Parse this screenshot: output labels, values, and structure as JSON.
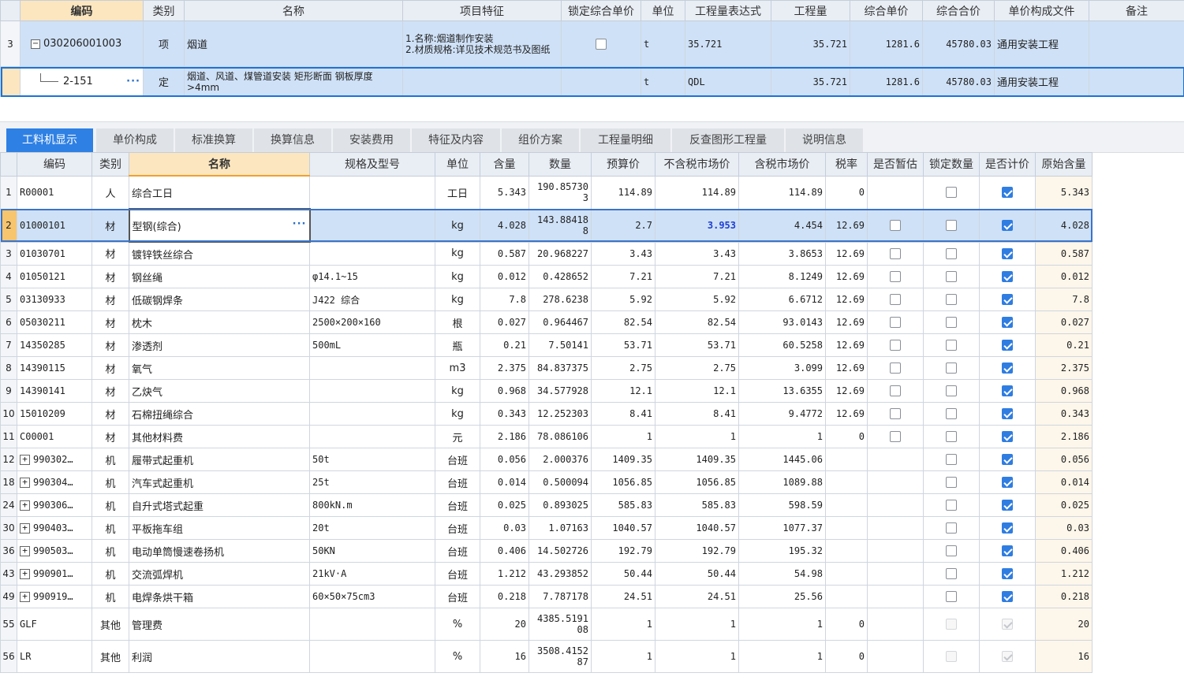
{
  "top_grid": {
    "headers": [
      "编码",
      "类别",
      "名称",
      "项目特征",
      "锁定综合单价",
      "单位",
      "工程量表达式",
      "工程量",
      "综合单价",
      "综合合价",
      "单价构成文件",
      "备注"
    ],
    "rows": [
      {
        "rowno": "3",
        "code": "030206001003",
        "type": "项",
        "name": "烟道",
        "feature_lines": [
          "1.名称:烟道制作安装",
          "2.材质规格:详见技术规范书及图纸"
        ],
        "lock_checked": false,
        "unit": "t",
        "expr": "35.721",
        "qty": "35.721",
        "unit_price": "1281.6",
        "total": "45780.03",
        "file": "通用安装工程",
        "note": ""
      },
      {
        "rowno": "",
        "code": "2-151",
        "type": "定",
        "name": "烟道、风道、煤管道安装 矩形断面 钢板厚度>4mm",
        "unit": "t",
        "expr": "QDL",
        "qty": "35.721",
        "unit_price": "1281.6",
        "total": "45780.03",
        "file": "通用安装工程",
        "note": ""
      }
    ],
    "dots": "···"
  },
  "tabs": [
    "工料机显示",
    "单价构成",
    "标准换算",
    "换算信息",
    "安装费用",
    "特征及内容",
    "组价方案",
    "工程量明细",
    "反查图形工程量",
    "说明信息"
  ],
  "active_tab": 0,
  "bottom_grid": {
    "headers": [
      "编码",
      "类别",
      "名称",
      "规格及型号",
      "单位",
      "含量",
      "数量",
      "预算价",
      "不含税市场价",
      "含税市场价",
      "税率",
      "是否暂估",
      "锁定数量",
      "是否计价",
      "原始含量"
    ],
    "rows": [
      {
        "no": "1",
        "code": "R00001",
        "type": "人",
        "name": "综合工日",
        "spec": "",
        "unit": "工日",
        "content": "5.343",
        "qty": "190.857303",
        "budget": "114.89",
        "mkt": "114.89",
        "mkt_tax": "114.89",
        "rate": "0",
        "est": null,
        "lock": false,
        "price": true,
        "orig": "5.343"
      },
      {
        "no": "2",
        "code": "01000101",
        "type": "材",
        "name": "型钢(综合)",
        "spec": "",
        "unit": "kg",
        "content": "4.028",
        "qty": "143.884188",
        "budget": "2.7",
        "mkt": "3.953",
        "mkt_tax": "4.454",
        "rate": "12.69",
        "est": false,
        "lock": false,
        "price": true,
        "orig": "4.028"
      },
      {
        "no": "3",
        "code": "01030701",
        "type": "材",
        "name": "镀锌铁丝综合",
        "spec": "",
        "unit": "kg",
        "content": "0.587",
        "qty": "20.968227",
        "budget": "3.43",
        "mkt": "3.43",
        "mkt_tax": "3.8653",
        "rate": "12.69",
        "est": false,
        "lock": false,
        "price": true,
        "orig": "0.587"
      },
      {
        "no": "4",
        "code": "01050121",
        "type": "材",
        "name": "钢丝绳",
        "spec": "φ14.1~15",
        "unit": "kg",
        "content": "0.012",
        "qty": "0.428652",
        "budget": "7.21",
        "mkt": "7.21",
        "mkt_tax": "8.1249",
        "rate": "12.69",
        "est": false,
        "lock": false,
        "price": true,
        "orig": "0.012"
      },
      {
        "no": "5",
        "code": "03130933",
        "type": "材",
        "name": "低碳钢焊条",
        "spec": "J422 综合",
        "unit": "kg",
        "content": "7.8",
        "qty": "278.6238",
        "budget": "5.92",
        "mkt": "5.92",
        "mkt_tax": "6.6712",
        "rate": "12.69",
        "est": false,
        "lock": false,
        "price": true,
        "orig": "7.8"
      },
      {
        "no": "6",
        "code": "05030211",
        "type": "材",
        "name": "枕木",
        "spec": "2500×200×160",
        "unit": "根",
        "content": "0.027",
        "qty": "0.964467",
        "budget": "82.54",
        "mkt": "82.54",
        "mkt_tax": "93.0143",
        "rate": "12.69",
        "est": false,
        "lock": false,
        "price": true,
        "orig": "0.027"
      },
      {
        "no": "7",
        "code": "14350285",
        "type": "材",
        "name": "渗透剂",
        "spec": "500mL",
        "unit": "瓶",
        "content": "0.21",
        "qty": "7.50141",
        "budget": "53.71",
        "mkt": "53.71",
        "mkt_tax": "60.5258",
        "rate": "12.69",
        "est": false,
        "lock": false,
        "price": true,
        "orig": "0.21"
      },
      {
        "no": "8",
        "code": "14390115",
        "type": "材",
        "name": "氧气",
        "spec": "",
        "unit": "m3",
        "content": "2.375",
        "qty": "84.837375",
        "budget": "2.75",
        "mkt": "2.75",
        "mkt_tax": "3.099",
        "rate": "12.69",
        "est": false,
        "lock": false,
        "price": true,
        "orig": "2.375"
      },
      {
        "no": "9",
        "code": "14390141",
        "type": "材",
        "name": "乙炔气",
        "spec": "",
        "unit": "kg",
        "content": "0.968",
        "qty": "34.577928",
        "budget": "12.1",
        "mkt": "12.1",
        "mkt_tax": "13.6355",
        "rate": "12.69",
        "est": false,
        "lock": false,
        "price": true,
        "orig": "0.968"
      },
      {
        "no": "10",
        "code": "15010209",
        "type": "材",
        "name": "石棉扭绳综合",
        "spec": "",
        "unit": "kg",
        "content": "0.343",
        "qty": "12.252303",
        "budget": "8.41",
        "mkt": "8.41",
        "mkt_tax": "9.4772",
        "rate": "12.69",
        "est": false,
        "lock": false,
        "price": true,
        "orig": "0.343"
      },
      {
        "no": "11",
        "code": "C00001",
        "type": "材",
        "name": "其他材料费",
        "spec": "",
        "unit": "元",
        "content": "2.186",
        "qty": "78.086106",
        "budget": "1",
        "mkt": "1",
        "mkt_tax": "1",
        "rate": "0",
        "est": false,
        "lock": false,
        "price": true,
        "orig": "2.186"
      },
      {
        "no": "12",
        "code": "990302…",
        "type": "机",
        "name": "履带式起重机",
        "spec": "50t",
        "unit": "台班",
        "content": "0.056",
        "qty": "2.000376",
        "budget": "1409.35",
        "mkt": "1409.35",
        "mkt_tax": "1445.06",
        "rate": "",
        "est": null,
        "lock": false,
        "price": true,
        "orig": "0.056",
        "expand": true
      },
      {
        "no": "18",
        "code": "990304…",
        "type": "机",
        "name": "汽车式起重机",
        "spec": "25t",
        "unit": "台班",
        "content": "0.014",
        "qty": "0.500094",
        "budget": "1056.85",
        "mkt": "1056.85",
        "mkt_tax": "1089.88",
        "rate": "",
        "est": null,
        "lock": false,
        "price": true,
        "orig": "0.014",
        "expand": true
      },
      {
        "no": "24",
        "code": "990306…",
        "type": "机",
        "name": "自升式塔式起重",
        "spec": "800kN.m",
        "unit": "台班",
        "content": "0.025",
        "qty": "0.893025",
        "budget": "585.83",
        "mkt": "585.83",
        "mkt_tax": "598.59",
        "rate": "",
        "est": null,
        "lock": false,
        "price": true,
        "orig": "0.025",
        "expand": true
      },
      {
        "no": "30",
        "code": "990403…",
        "type": "机",
        "name": "平板拖车组",
        "spec": "20t",
        "unit": "台班",
        "content": "0.03",
        "qty": "1.07163",
        "budget": "1040.57",
        "mkt": "1040.57",
        "mkt_tax": "1077.37",
        "rate": "",
        "est": null,
        "lock": false,
        "price": true,
        "orig": "0.03",
        "expand": true
      },
      {
        "no": "36",
        "code": "990503…",
        "type": "机",
        "name": "电动单筒慢速卷扬机",
        "spec": "50KN",
        "unit": "台班",
        "content": "0.406",
        "qty": "14.502726",
        "budget": "192.79",
        "mkt": "192.79",
        "mkt_tax": "195.32",
        "rate": "",
        "est": null,
        "lock": false,
        "price": true,
        "orig": "0.406",
        "expand": true
      },
      {
        "no": "43",
        "code": "990901…",
        "type": "机",
        "name": "交流弧焊机",
        "spec": "21kV·A",
        "unit": "台班",
        "content": "1.212",
        "qty": "43.293852",
        "budget": "50.44",
        "mkt": "50.44",
        "mkt_tax": "54.98",
        "rate": "",
        "est": null,
        "lock": false,
        "price": true,
        "orig": "1.212",
        "expand": true
      },
      {
        "no": "49",
        "code": "990919…",
        "type": "机",
        "name": "电焊条烘干箱",
        "spec": "60×50×75cm3",
        "unit": "台班",
        "content": "0.218",
        "qty": "7.787178",
        "budget": "24.51",
        "mkt": "24.51",
        "mkt_tax": "25.56",
        "rate": "",
        "est": null,
        "lock": false,
        "price": true,
        "orig": "0.218",
        "expand": true
      },
      {
        "no": "55",
        "code": "GLF",
        "type": "其他",
        "name": "管理费",
        "spec": "",
        "unit": "%",
        "content": "20",
        "qty": "4385.519108",
        "budget": "1",
        "mkt": "1",
        "mkt_tax": "1",
        "rate": "0",
        "est": null,
        "lock": "dis",
        "price": "dis",
        "orig": "20"
      },
      {
        "no": "56",
        "code": "LR",
        "type": "其他",
        "name": "利润",
        "spec": "",
        "unit": "%",
        "content": "16",
        "qty": "3508.415287",
        "budget": "1",
        "mkt": "1",
        "mkt_tax": "1",
        "rate": "0",
        "est": null,
        "lock": "dis",
        "price": "dis",
        "orig": "16"
      }
    ],
    "selected_row": 1,
    "highlight_cell": "mkt"
  },
  "colors": {
    "accent": "#2f80e4",
    "selection": "#cfe1f7",
    "header": "#e9eef5",
    "key_header": "#fbe6bf",
    "highlight_text": "#1f3fd1"
  }
}
